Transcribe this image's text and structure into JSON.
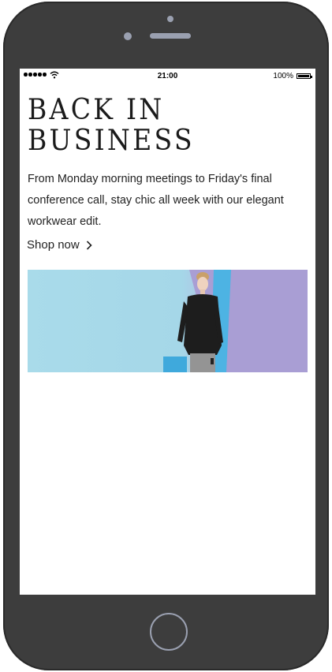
{
  "status_bar": {
    "time": "21:00",
    "battery": "100%"
  },
  "content": {
    "headline_line1": "BACK IN",
    "headline_line2": "BUSINESS",
    "body": "From Monday morning meetings to Friday's final conference call, stay chic all week with our elegant workwear edit.",
    "shop_link": "Shop now"
  },
  "icons": {
    "signal": "signal-dots-icon",
    "wifi": "wifi-icon",
    "battery": "battery-icon",
    "chevron": "chevron-right-icon"
  },
  "colors": {
    "phone_body": "#3d3d3d",
    "banner_blue": "#a9dbea",
    "banner_lilac": "#a79bd2",
    "text": "#222222"
  }
}
